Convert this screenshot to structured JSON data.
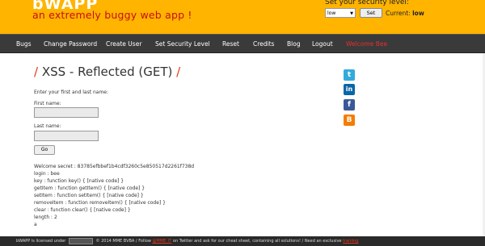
{
  "header": {
    "logo": "bWAPP",
    "tagline": "an extremely buggy web app !",
    "security_label": "Set your security level:",
    "security_select_value": "low",
    "set_button": "Set",
    "current_prefix": "Current:",
    "current_level": "low"
  },
  "nav": [
    {
      "label": "Bugs"
    },
    {
      "label": "Change Password"
    },
    {
      "label": "Create User"
    },
    {
      "label": "Set Security Level"
    },
    {
      "label": "Reset"
    },
    {
      "label": "Credits"
    },
    {
      "label": "Blog"
    },
    {
      "label": "Logout"
    },
    {
      "label": "Welcome Bee"
    }
  ],
  "page": {
    "title_slash": "/",
    "title": "XSS - Reflected (GET)",
    "intro": "Enter your first and last name:",
    "first_label": "First name:",
    "last_label": "Last name:",
    "go_button": "Go"
  },
  "output": [
    "Welcome secret : 83785efbbef1b4cdf3260c5e850517d2261f738d",
    "login : bee",
    "key : function key() { [native code] }",
    "getItem : function getItem() { [native code] }",
    "setItem : function setItem() { [native code] }",
    "removeItem : function removeItem() { [native code] }",
    "clear : function clear() { [native code] }",
    "length : 2",
    "a"
  ],
  "social": {
    "twitter_glyph": "t",
    "linkedin_glyph": "in",
    "facebook_glyph": "f",
    "blogger_glyph": "B"
  },
  "footer": {
    "part1": "bWAPP is licensed under",
    "part2": "© 2014 MME BVBA / Follow",
    "link1": "@MME_IT",
    "part3": "on Twitter and ask for our cheat sheet, containing all solutions! / Need an exclusive",
    "link2": "training"
  }
}
